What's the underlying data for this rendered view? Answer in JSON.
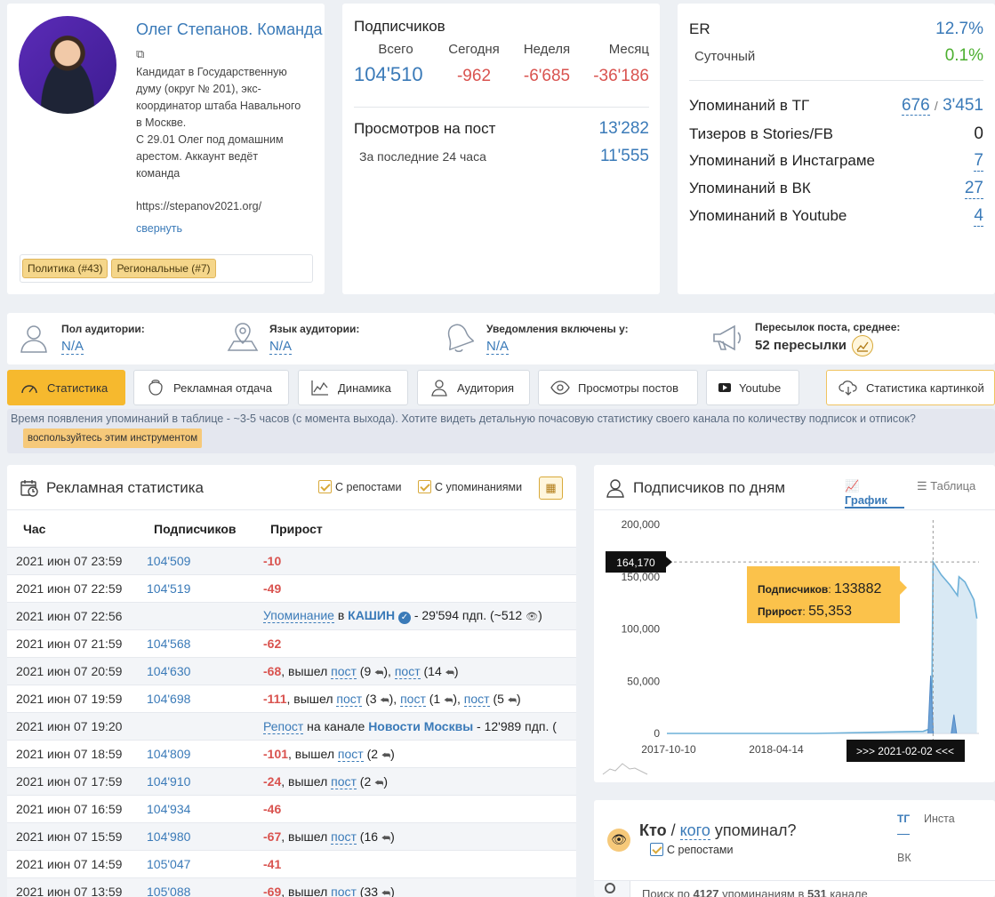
{
  "profile": {
    "name": "Олег Степанов. Команда",
    "description_lines": [
      "Кандидат в Государственную",
      "думу (округ № 201), экс-",
      "координатор штаба Навального",
      "в Москве.",
      "С 29.01 Олег под домашним",
      "арестом. Аккаунт ведёт",
      "команда"
    ],
    "url": "https://stepanov2021.org/",
    "collapse": "свернуть",
    "tags": [
      "Политика (#43)",
      "Региональные (#7)"
    ]
  },
  "subs": {
    "title": "Подписчиков",
    "labels": [
      "Всего",
      "Сегодня",
      "Неделя",
      "Месяц"
    ],
    "total": "104'510",
    "today": "-962",
    "week": "-6'685",
    "month": "-36'186",
    "views_label": "Просмотров на пост",
    "views": "13'282",
    "last24_label": "За последние 24 часа",
    "last24": "11'555"
  },
  "er": {
    "label": "ER",
    "value": "12.7%",
    "daily_label": "Суточный",
    "daily": "0.1%",
    "tg_label": "Упоминаний в ТГ",
    "tg_a": "676",
    "tg_b": "3'451",
    "teasers_label": "Тизеров в Stories/FB",
    "teasers": "0",
    "insta_label": "Упоминаний в Инстаграме",
    "insta": "7",
    "vk_label": "Упоминаний в ВК",
    "vk": "27",
    "yt_label": "Упоминаний в Youtube",
    "yt": "4"
  },
  "info": {
    "gender_label": "Пол аудитории:",
    "gender": "N/A",
    "lang_label": "Язык аудитории:",
    "lang": "N/A",
    "notif_label": "Уведомления включены у:",
    "notif": "N/A",
    "fwd_label": "Пересылок поста, среднее:",
    "fwd": "52 пересылки"
  },
  "tabs": [
    "Статистика",
    "Рекламная отдача",
    "Динамика",
    "Аудитория",
    "Просмотры постов",
    "Youtube",
    "Статистика картинкой"
  ],
  "notice": {
    "text": "Время появления упоминаний в таблице - ~3-5 часов (с момента выхода). Хотите видеть детальную почасовую статистику своего канала по количеству подписок и отписок?",
    "button": "воспользуйтесь этим инструментом"
  },
  "ad": {
    "title": "Рекламная статистика",
    "chk1": "С репостами",
    "chk2": "С упоминаниями",
    "cols": [
      "Час",
      "Подписчиков",
      "Прирост"
    ],
    "rows": [
      {
        "t": "2021 июн 07 23:59",
        "s": "104'509",
        "d": "-10",
        "x": ""
      },
      {
        "t": "2021 июн 07 22:59",
        "s": "104'519",
        "d": "-49",
        "x": ""
      },
      {
        "t": "2021 июн 07 22:56",
        "s": "",
        "d": "",
        "x": "mention"
      },
      {
        "t": "2021 июн 07 21:59",
        "s": "104'568",
        "d": "-62",
        "x": ""
      },
      {
        "t": "2021 июн 07 20:59",
        "s": "104'630",
        "d": "-68",
        "x": ", вышел "
      },
      {
        "t": "2021 июн 07 19:59",
        "s": "104'698",
        "d": "-111",
        "x": ", вышел "
      },
      {
        "t": "2021 июн 07 19:20",
        "s": "",
        "d": "",
        "x": "repost"
      },
      {
        "t": "2021 июн 07 18:59",
        "s": "104'809",
        "d": "-101",
        "x": ", вышел "
      },
      {
        "t": "2021 июн 07 17:59",
        "s": "104'910",
        "d": "-24",
        "x": ", вышел "
      },
      {
        "t": "2021 июн 07 16:59",
        "s": "104'934",
        "d": "-46",
        "x": ""
      },
      {
        "t": "2021 июн 07 15:59",
        "s": "104'980",
        "d": "-67",
        "x": ", вышел "
      },
      {
        "t": "2021 июн 07 14:59",
        "s": "105'047",
        "d": "-41",
        "x": ""
      },
      {
        "t": "2021 июн 07 13:59",
        "s": "105'088",
        "d": "-69",
        "x": ", вышел "
      }
    ],
    "post": "пост",
    "mention_word": "Упоминание",
    "in_word": " в ",
    "mention_ch": "КАШИН",
    "mention_tail": " - 29'594 пдп. (~512",
    "repost_word": "Репост",
    "repost_mid": " на канале ",
    "repost_ch": "Новости Москвы",
    "repost_tail": " - 12'989 пдп. (",
    "posts": {
      "r4": [
        "(9",
        "(14"
      ],
      "r5": [
        "(3",
        "(1",
        "(5"
      ],
      "r7": [
        "(2"
      ],
      "r8": [
        "(2"
      ],
      "r10": [
        "(16"
      ],
      "r12": [
        "(33"
      ]
    },
    "close": ")"
  },
  "chart_panel": {
    "title": "Подписчиков по дням",
    "tab_graph": "График",
    "tab_table": "Таблица",
    "cursor": "164,170",
    "tip_subs_label": "Подписчиков",
    "tip_subs": "133882",
    "tip_gain_label": "Прирост",
    "tip_gain": "55,353",
    "range": ">>> 2021-02-02 <<<"
  },
  "chart_data": {
    "type": "area",
    "title": "Подписчиков по дням",
    "x_ticks": [
      "2017-10-10",
      "2018-04-14"
    ],
    "y_ticks": [
      "200,000",
      "150,000",
      "100,000",
      "50,000",
      "0"
    ],
    "ylim": [
      0,
      200000
    ],
    "series": [
      {
        "values": [
          [
            0,
            0
          ],
          [
            0.5,
            0
          ],
          [
            0.86,
            2000
          ],
          [
            0.888,
            5000
          ],
          [
            0.893,
            164170
          ],
          [
            0.92,
            152000
          ],
          [
            0.95,
            142000
          ],
          [
            0.97,
            134000
          ],
          [
            0.975,
            132000
          ],
          [
            0.98,
            150000
          ],
          [
            1.0,
            145000
          ],
          [
            1.03,
            128000
          ],
          [
            1.04,
            110000
          ]
        ]
      }
    ],
    "spikes": [
      [
        0.885,
        55353
      ],
      [
        0.963,
        18000
      ]
    ]
  },
  "who": {
    "title_a": "Кто",
    "sep": " / ",
    "title_b": "кого",
    "title_c": " упоминал?",
    "chk": "С репостами",
    "tabs": [
      "ТГ",
      "Инста",
      "ВК"
    ],
    "search": "Поиск по 4127 упоминаниям в 531 канале"
  }
}
